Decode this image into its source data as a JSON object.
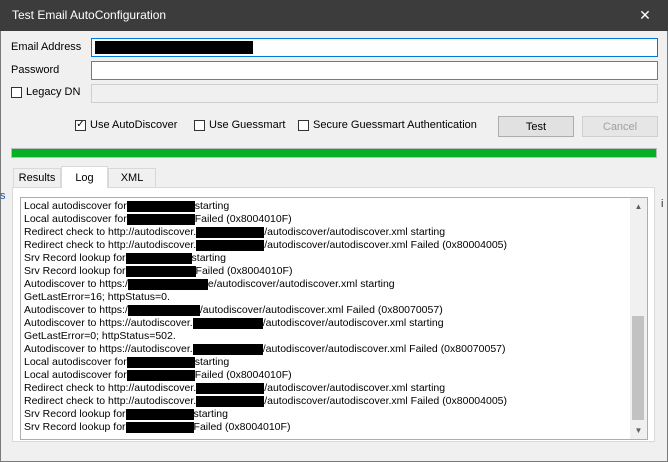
{
  "window": {
    "title": "Test Email AutoConfiguration",
    "close_label": "✕"
  },
  "form": {
    "email_label": "Email Address",
    "password_label": "Password",
    "legacy_dn_label": "Legacy DN",
    "use_autodiscover_label": "Use AutoDiscover",
    "use_autodiscover_checked": true,
    "use_guessmart_label": "Use Guessmart",
    "use_guessmart_checked": false,
    "secure_guessmart_label": "Secure Guessmart Authentication",
    "secure_guessmart_checked": false,
    "legacy_dn_checked": false
  },
  "buttons": {
    "test": "Test",
    "cancel": "Cancel"
  },
  "progress": {
    "percent": 100,
    "color": "#06b025"
  },
  "tabs": [
    {
      "label": "Results"
    },
    {
      "label": "Log"
    },
    {
      "label": "XML"
    }
  ],
  "active_tab": "Log",
  "log": {
    "lines": [
      {
        "pre": "Local autodiscover for",
        "post": "starting"
      },
      {
        "pre": "Local autodiscover for",
        "post": "Failed (0x8004010F)"
      },
      {
        "pre": "Redirect check to http://autodiscover.",
        "post": "/autodiscover/autodiscover.xml starting"
      },
      {
        "pre": "Redirect check to http://autodiscover.",
        "post": "/autodiscover/autodiscover.xml Failed (0x80004005)"
      },
      {
        "pre": "Srv Record lookup for",
        "post": "starting"
      },
      {
        "pre": "Srv Record lookup for",
        "post": "Failed (0x8004010F)"
      },
      {
        "pre": "Autodiscover to https:/",
        "post": "e/autodiscover/autodiscover.xml starting"
      },
      {
        "pre": "GetLastError=16; httpStatus=0.",
        "post": ""
      },
      {
        "pre": "Autodiscover to https:/",
        "post": "/autodiscover/autodiscover.xml Failed (0x80070057)"
      },
      {
        "pre": "Autodiscover to https://autodiscover.",
        "post": "/autodiscover/autodiscover.xml starting"
      },
      {
        "pre": "GetLastError=0; httpStatus=502.",
        "post": ""
      },
      {
        "pre": "Autodiscover to https://autodiscover.",
        "post": "/autodiscover/autodiscover.xml Failed (0x80070057)"
      },
      {
        "pre": "Local autodiscover for",
        "post": "starting"
      },
      {
        "pre": "Local autodiscover for",
        "post": "Failed (0x8004010F)"
      },
      {
        "pre": "Redirect check to http://autodiscover.",
        "post": "/autodiscover/autodiscover.xml starting"
      },
      {
        "pre": "Redirect check to http://autodiscover.",
        "post": "/autodiscover/autodiscover.xml Failed (0x80004005)"
      },
      {
        "pre": "Srv Record lookup for",
        "post": "starting"
      },
      {
        "pre": "Srv Record lookup for",
        "post": "Failed (0x8004010F)"
      }
    ]
  }
}
